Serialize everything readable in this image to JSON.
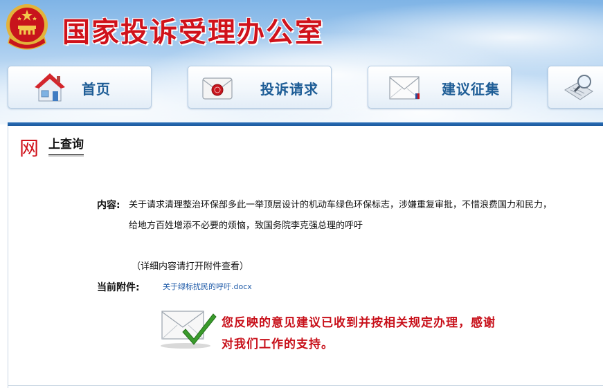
{
  "header": {
    "site_title": "国家投诉受理办公室",
    "brand_color": "#d0121b",
    "emblem_icon": "national-emblem-icon"
  },
  "nav": {
    "items": [
      {
        "label": "首页",
        "icon": "home-icon"
      },
      {
        "label": "投诉请求",
        "icon": "envelope-seal-icon"
      },
      {
        "label": "建议征集",
        "icon": "envelope-icon"
      },
      {
        "label": "",
        "icon": "search-magnifier-icon"
      }
    ],
    "label_color": "#1e5d96"
  },
  "panel": {
    "title_big_char": "网",
    "title_rest": "上查询",
    "accent_bar_color": "#1d5a9e"
  },
  "record": {
    "content_label": "内容:",
    "content_line1": "关于请求清理整治环保部多此一举顶层设计的机动车绿色环保标志，涉嫌重复审批，不惜浪费国力和民力，",
    "content_line2": "给地方百姓增添不必要的烦恼，致国务院李克强总理的呼吁",
    "detail_note": "（详细内容请打开附件查看）",
    "attachment_label": "当前附件:",
    "attachment_name": "关于绿标扰民的呼吁.docx"
  },
  "reply": {
    "icon": "envelope-checkmark-icon",
    "line1": "您反映的意见建议已收到并按相关规定办理，感谢",
    "line2": "对我们工作的支持。",
    "color": "#c8101a"
  }
}
